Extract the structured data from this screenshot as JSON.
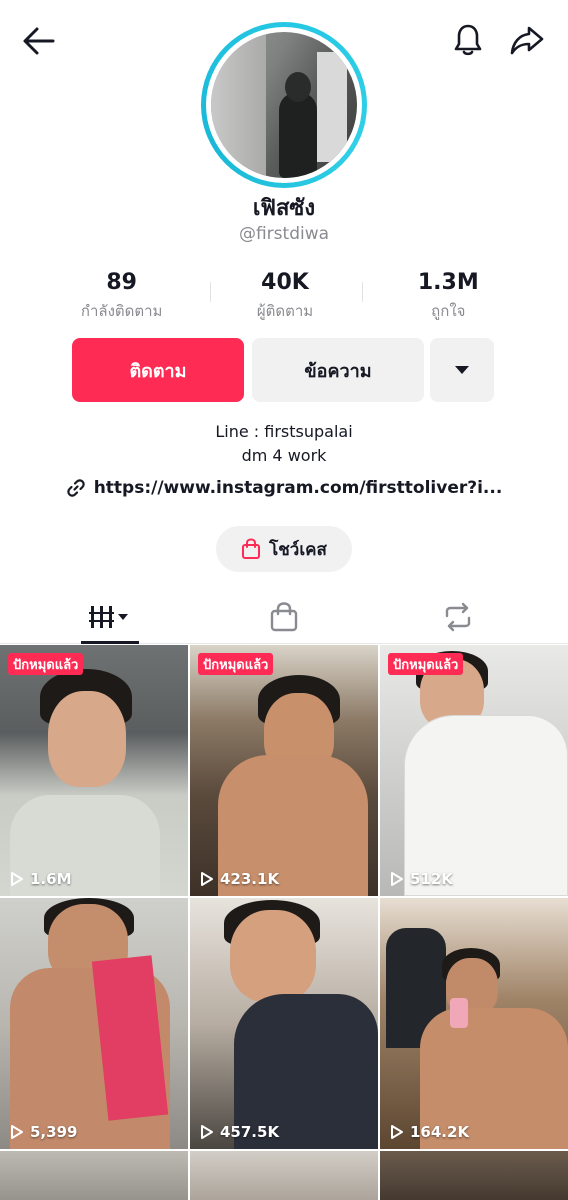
{
  "profile": {
    "display_name": "เฟิสซัง",
    "username": "@firstdiwa"
  },
  "stats": [
    {
      "value": "89",
      "label": "กำลังติดตาม"
    },
    {
      "value": "40K",
      "label": "ผู้ติดตาม"
    },
    {
      "value": "1.3M",
      "label": "ถูกใจ"
    }
  ],
  "actions": {
    "follow_label": "ติดตาม",
    "message_label": "ข้อความ"
  },
  "bio": {
    "line1": "Line : firstsupalai",
    "line2": "dm 4 work",
    "link": "https://www.instagram.com/firsttoliver?i..."
  },
  "showcase": {
    "label": "โชว์เคส"
  },
  "tabs": [
    {
      "name": "videos",
      "icon": "grid-icon",
      "active": true
    },
    {
      "name": "shop",
      "icon": "shopping-bag-icon",
      "active": false
    },
    {
      "name": "reposts",
      "icon": "repost-icon",
      "active": false
    }
  ],
  "videos": [
    {
      "pinned_label": "ปักหมุดแล้ว",
      "views": "1.6M"
    },
    {
      "pinned_label": "ปักหมุดแล้ว",
      "views": "423.1K"
    },
    {
      "pinned_label": "ปักหมุดแล้ว",
      "views": "512K"
    },
    {
      "pinned_label": "",
      "views": "5,399"
    },
    {
      "pinned_label": "",
      "views": "457.5K"
    },
    {
      "pinned_label": "",
      "views": "164.2K"
    },
    {
      "pinned_label": "",
      "views": ""
    },
    {
      "pinned_label": "",
      "views": ""
    },
    {
      "pinned_label": "",
      "views": ""
    }
  ],
  "colors": {
    "accent": "#fe2c55",
    "avatar_ring": "#25c7e3",
    "secondary_bg": "#f1f1f2",
    "muted_text": "#8a8b91"
  }
}
